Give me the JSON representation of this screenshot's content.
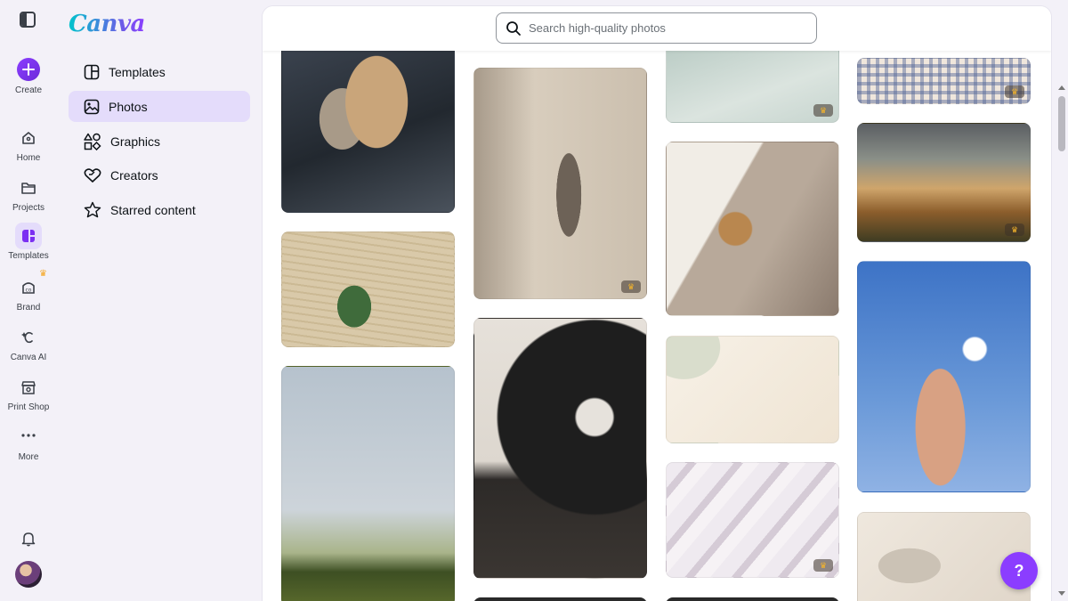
{
  "rail": {
    "create_label": "Create",
    "items": [
      {
        "label": "Home",
        "icon": "home-icon"
      },
      {
        "label": "Projects",
        "icon": "folder-icon"
      },
      {
        "label": "Templates",
        "icon": "templates-icon"
      },
      {
        "label": "Brand",
        "icon": "brand-icon"
      },
      {
        "label": "Canva AI",
        "icon": "canva-ai-icon"
      },
      {
        "label": "Print Shop",
        "icon": "print-shop-icon"
      },
      {
        "label": "More",
        "icon": "more-icon"
      }
    ],
    "bell_icon": "bell-icon",
    "crown_icon": "♛"
  },
  "panel": {
    "logo": "Canva",
    "items": [
      {
        "label": "Templates",
        "icon": "templates-icon"
      },
      {
        "label": "Photos",
        "icon": "photos-icon",
        "active": true
      },
      {
        "label": "Graphics",
        "icon": "graphics-icon"
      },
      {
        "label": "Creators",
        "icon": "creators-icon"
      },
      {
        "label": "Starred content",
        "icon": "star-icon"
      }
    ]
  },
  "search": {
    "placeholder": "Search high-quality photos",
    "value": ""
  },
  "photos": {
    "crown": "♛",
    "items": [
      {
        "name": "bags-in-car",
        "premium": false
      },
      {
        "name": "tulips-on-book",
        "premium": false
      },
      {
        "name": "sky-wildflowers",
        "premium": false
      },
      {
        "name": "tulip-shadow",
        "premium": true
      },
      {
        "name": "record-player",
        "premium": false
      },
      {
        "name": "mint-texture",
        "premium": true
      },
      {
        "name": "reading-coffee",
        "premium": false
      },
      {
        "name": "cream-abstract",
        "premium": false
      },
      {
        "name": "white-silk",
        "premium": true
      },
      {
        "name": "plaid-fabric",
        "premium": true
      },
      {
        "name": "golden-field",
        "premium": true
      },
      {
        "name": "hand-daisy-sky",
        "premium": false
      },
      {
        "name": "leaf-shadow",
        "premium": false
      }
    ]
  },
  "help": {
    "label": "?"
  },
  "colors": {
    "accent": "#8b3dff",
    "active_bg": "#e4dcfb",
    "crown": "#f6b52a"
  }
}
